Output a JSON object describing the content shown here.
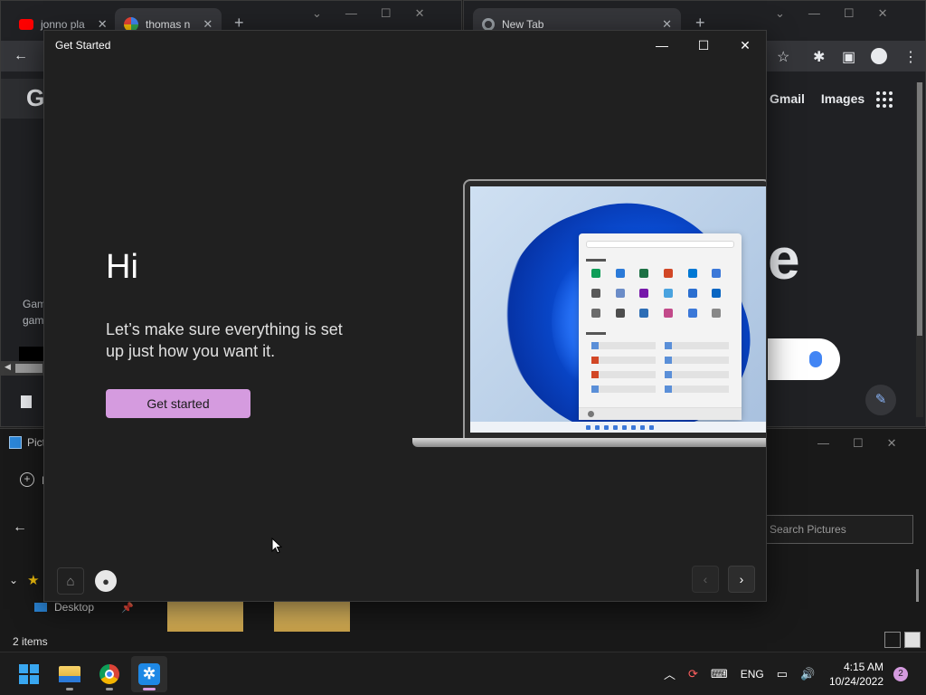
{
  "left_browser": {
    "tabs": [
      {
        "title": "jonno pla",
        "icon": "youtube-icon"
      },
      {
        "title": "thomas n",
        "icon": "google-icon"
      }
    ],
    "page_text_1": "Gam",
    "page_text_2": "gam",
    "google_letter": "G"
  },
  "right_browser": {
    "tab_title": "New Tab",
    "links": [
      "Gmail",
      "Images"
    ],
    "logo_fragment": "e"
  },
  "explorer": {
    "title_fragment": "Pict",
    "nav_letter": "I",
    "search_placeholder": "Search Pictures",
    "quick_access_item": "Desktop",
    "status": "2 items"
  },
  "dialog": {
    "window_title": "Get Started",
    "heading": "Hi",
    "subtitle": "Let’s make sure everything is set up just how you want it.",
    "cta_label": "Get started"
  },
  "taskbar": {
    "apps": [
      "start",
      "file-explorer",
      "chrome",
      "get-started"
    ],
    "language": "ENG",
    "time": "4:15 AM",
    "date": "10/24/2022",
    "notification_count": "2"
  },
  "colors": {
    "accent": "#d59bdf",
    "dialog_bg": "#202020",
    "browser_bg": "#202124"
  }
}
